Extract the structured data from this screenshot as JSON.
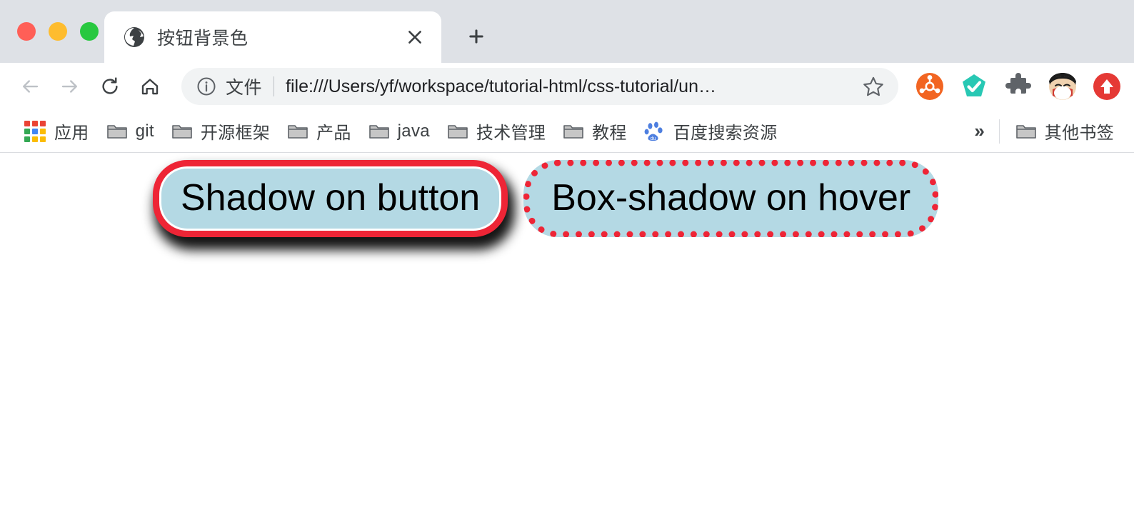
{
  "window": {
    "traffic_lights": [
      {
        "name": "close",
        "color": "#ff5f57"
      },
      {
        "name": "minimize",
        "color": "#febc2e"
      },
      {
        "name": "zoom",
        "color": "#28c840"
      }
    ]
  },
  "tabs": [
    {
      "title": "按钮背景色",
      "favicon": "globe-icon",
      "active": true
    }
  ],
  "tabstrip": {
    "new_tab_label": "+",
    "close_label": "×"
  },
  "toolbar": {
    "back_label": "←",
    "forward_label": "→",
    "reload_label": "⟳",
    "home_label": "⌂",
    "extensions": [
      {
        "name": "hub-extension-icon",
        "color": "#f26522"
      },
      {
        "name": "shield-check-extension-icon",
        "color": "#28c8b4"
      },
      {
        "name": "puzzle-extensions-icon",
        "color": "#5f6368"
      },
      {
        "name": "user-avatar",
        "color": "#f7a072"
      },
      {
        "name": "upload-arrow-extension-icon",
        "color": "#e53935"
      }
    ]
  },
  "omnibox": {
    "info_icon": "info-circle-icon",
    "scheme_label": "文件",
    "url": "file:///Users/yf/workspace/tutorial-html/css-tutorial/un…",
    "star_icon": "bookmark-star-icon"
  },
  "bookmarks": {
    "items": [
      {
        "label": "应用",
        "icon": "apps-grid-icon"
      },
      {
        "label": "git",
        "icon": "folder-icon"
      },
      {
        "label": "开源框架",
        "icon": "folder-icon"
      },
      {
        "label": "产品",
        "icon": "folder-icon"
      },
      {
        "label": "java",
        "icon": "folder-icon"
      },
      {
        "label": "技术管理",
        "icon": "folder-icon"
      },
      {
        "label": "教程",
        "icon": "folder-icon"
      },
      {
        "label": "百度搜索资源",
        "icon": "baidu-paw-icon"
      }
    ],
    "overflow_label": "»",
    "other_bookmarks": {
      "label": "其他书签",
      "icon": "folder-icon"
    }
  },
  "page": {
    "background": "#ffffff",
    "buttons": [
      {
        "label": "Shadow on button",
        "background": "#b4d9e4",
        "border_color": "#ee2536",
        "border_style": "solid",
        "has_drop_shadow": true
      },
      {
        "label": "Box-shadow on hover",
        "background": "#b4d9e4",
        "border_color": "#ee2536",
        "border_style": "dotted",
        "has_drop_shadow": false
      }
    ]
  }
}
